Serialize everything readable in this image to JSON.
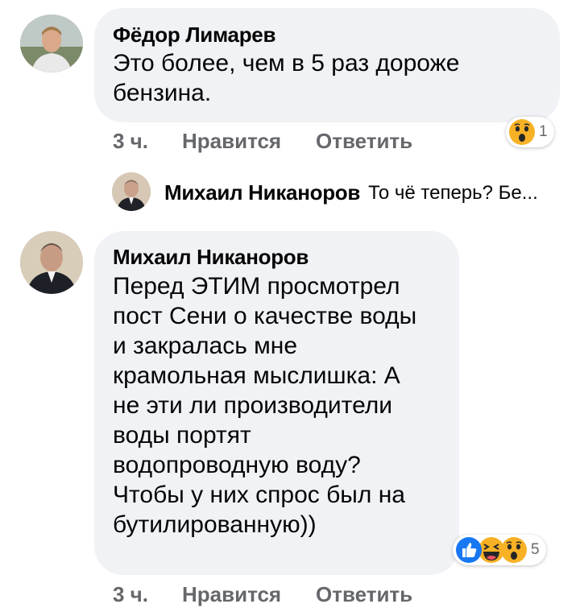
{
  "comment1": {
    "author": "Фёдор Лимарев",
    "text": "Это более, чем  в 5 раз дороже\nбензина.",
    "time": "3 ч.",
    "like_label": "Нравится",
    "reply_label": "Ответить",
    "reaction_count": "1",
    "reactions": [
      "wow-emoji-icon"
    ]
  },
  "reply_preview": {
    "author": "Михаил Никаноров",
    "text": "То чё теперь? Бе..."
  },
  "comment2": {
    "author": "Михаил Никаноров",
    "text": "Перед ЭТИМ просмотрел\nпост Сени о качестве воды\nи закралась мне\nкрамольная мыслишка: А\nне эти ли производители\nводы портят\nводопроводную воду?\nЧтобы у них спрос был на\nбутилированную))",
    "time": "3 ч.",
    "like_label": "Нравится",
    "reply_label": "Ответить",
    "reaction_count": "5",
    "reactions": [
      "like-icon",
      "haha-emoji-icon",
      "wow-emoji-icon"
    ]
  },
  "colors": {
    "bubble": "#f0f2f5",
    "meta_text": "#65676b",
    "like_blue": "#1877f2",
    "emoji_yellow": "#f7b125"
  }
}
